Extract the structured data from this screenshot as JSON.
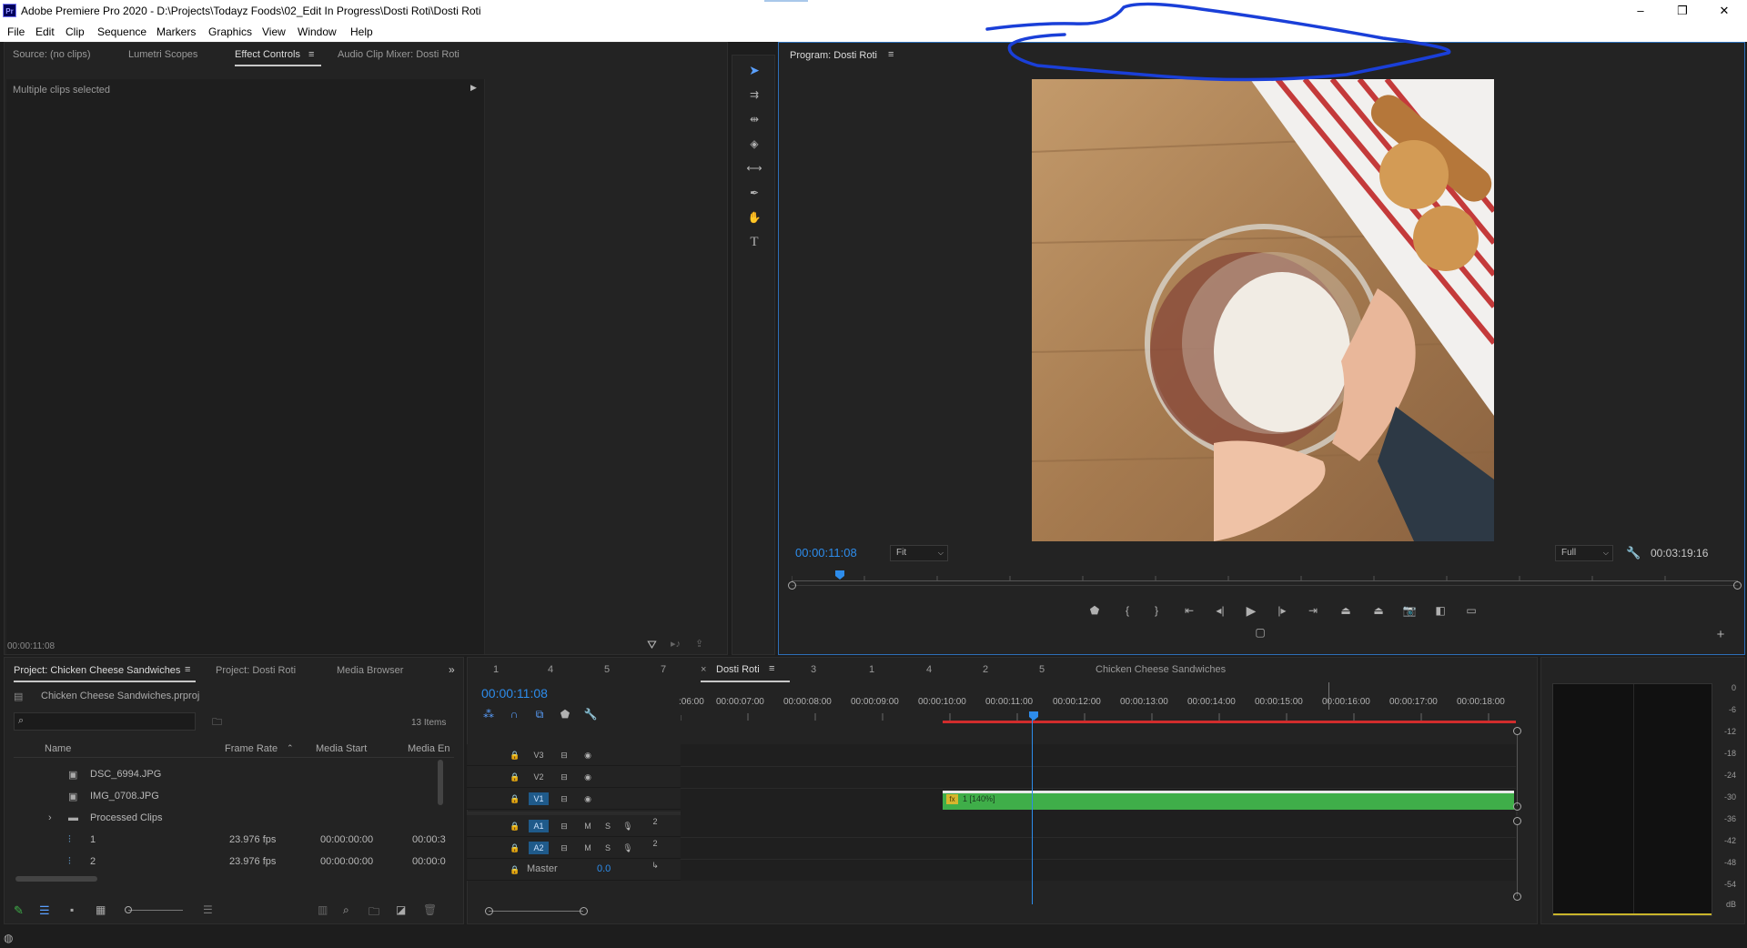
{
  "window": {
    "title": "Adobe Premiere Pro 2020 - D:\\Projects\\Todayz Foods\\02_Edit In Progress\\Dosti Roti\\Dosti Roti",
    "logo": "Pr",
    "minimize": "–",
    "restore": "❐",
    "close": "✕"
  },
  "menu": [
    "File",
    "Edit",
    "Clip",
    "Sequence",
    "Markers",
    "Graphics",
    "View",
    "Window",
    "Help"
  ],
  "source_panel": {
    "tabs": [
      "Source: (no clips)",
      "Lumetri Scopes",
      "Effect Controls",
      "Audio Clip Mixer: Dosti Roti"
    ],
    "active": "Effect Controls",
    "status": "Multiple clips selected",
    "timecode": "00:00:11:08"
  },
  "tools": [
    "selection-tool",
    "track-select-tool",
    "ripple-edit-tool",
    "razor-tool",
    "slip-tool",
    "pen-tool",
    "hand-tool",
    "type-tool"
  ],
  "program": {
    "title": "Program: Dosti Roti",
    "timecode": "00:00:11:08",
    "fit": "Fit",
    "quality": "Full",
    "duration": "00:03:19:16"
  },
  "project": {
    "tabs": [
      "Project: Chicken Cheese Sandwiches",
      "Project: Dosti Roti",
      "Media Browser"
    ],
    "file": "Chicken Cheese Sandwiches.prproj",
    "items_count": "13 Items",
    "columns": [
      "Name",
      "Frame Rate",
      "Media Start",
      "Media En"
    ],
    "rows": [
      {
        "name": "DSC_6994.JPG",
        "fps": "",
        "start": "",
        "end": ""
      },
      {
        "name": "IMG_0708.JPG",
        "fps": "",
        "start": "",
        "end": ""
      },
      {
        "name": "Processed Clips",
        "fps": "",
        "start": "",
        "end": ""
      },
      {
        "name": "1",
        "fps": "23.976 fps",
        "start": "00:00:00:00",
        "end": "00:00:3"
      },
      {
        "name": "2",
        "fps": "23.976 fps",
        "start": "00:00:00:00",
        "end": "00:00:0"
      }
    ]
  },
  "timeline": {
    "tabs_before": [
      "1",
      "4",
      "5",
      "7"
    ],
    "active_tab": "Dosti Roti",
    "tabs_after": [
      "3",
      "1",
      "4",
      "2",
      "5"
    ],
    "seq_label": "Chicken Cheese Sandwiches",
    "timecode": "00:00:11:08",
    "ruler": [
      ":06:00",
      "00:00:07:00",
      "00:00:08:00",
      "00:00:09:00",
      "00:00:10:00",
      "00:00:11:00",
      "00:00:12:00",
      "00:00:13:00",
      "00:00:14:00",
      "00:00:15:00",
      "00:00:16:00",
      "00:00:17:00",
      "00:00:18:00"
    ],
    "tracks": [
      "V3",
      "V2",
      "V1",
      "A1",
      "A2"
    ],
    "master": "Master",
    "master_val": "0.0",
    "clip_label": "1 [140%]",
    "clip_fx": "fx",
    "mute": "M",
    "solo": "S",
    "channel": "2"
  },
  "meter": {
    "labels": [
      "0",
      "-6",
      "-12",
      "-18",
      "-24",
      "-30",
      "-36",
      "-42",
      "-48",
      "-54",
      "dB"
    ]
  },
  "colors": {
    "accent": "#2d8ceb",
    "clip": "#3fae49",
    "playhead": "#2d8ceb",
    "render_bar": "#d12c2c",
    "annotation": "#1a3fd8"
  }
}
